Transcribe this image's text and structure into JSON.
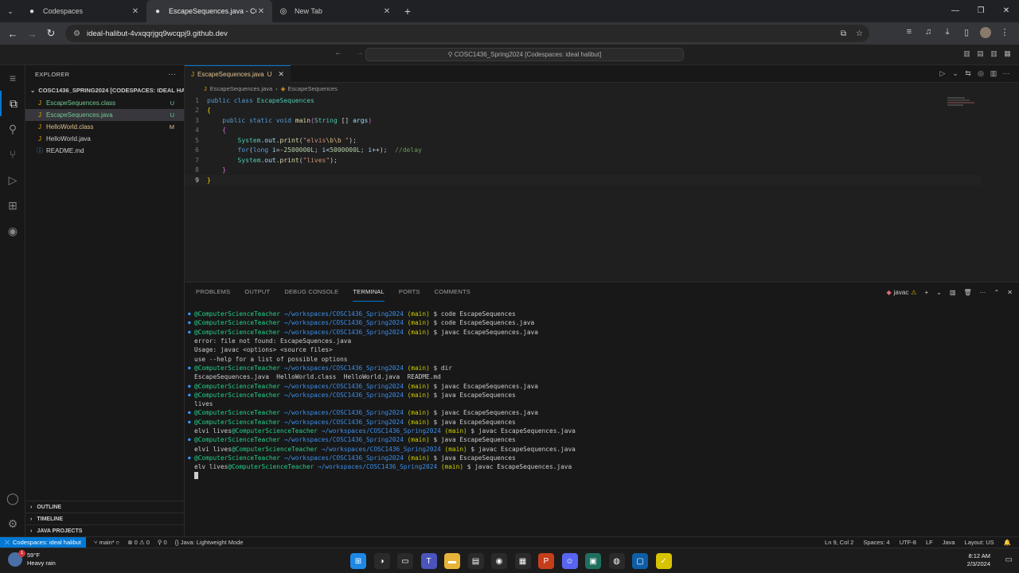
{
  "browser": {
    "tabs": [
      {
        "title": "Codespaces",
        "icon": "github-icon",
        "active": false
      },
      {
        "title": "EscapeSequences.java - COSC1",
        "icon": "github-icon",
        "active": true
      },
      {
        "title": "New Tab",
        "icon": "chrome-icon",
        "active": false
      }
    ],
    "url": "ideal-halibut-4vxqqrjgq9wcqpj9.github.dev"
  },
  "vscode": {
    "command_center": "COSC1436_Spring2024 [Codespaces: ideal halibut]",
    "explorer": {
      "title": "EXPLORER",
      "folder": "COSC1436_SPRING2024 [CODESPACES: IDEAL HALI...",
      "files": [
        {
          "name": "EscapeSequences.class",
          "status": "U",
          "color": "#73c991",
          "icon_color": "#e2a000",
          "selected": false
        },
        {
          "name": "EscapeSequences.java",
          "status": "U",
          "color": "#73c991",
          "icon_color": "#e2a000",
          "selected": true
        },
        {
          "name": "HelloWorld.class",
          "status": "M",
          "color": "#e2c08d",
          "icon_color": "#e2a000",
          "selected": false
        },
        {
          "name": "HelloWorld.java",
          "status": "",
          "color": "#cccccc",
          "icon_color": "#e2a000",
          "selected": false
        },
        {
          "name": "README.md",
          "status": "",
          "color": "#cccccc",
          "icon_color": "#519aba",
          "selected": false
        }
      ],
      "sections": [
        "OUTLINE",
        "TIMELINE",
        "JAVA PROJECTS"
      ]
    },
    "editor": {
      "tab_name": "EscapeSequences.java",
      "tab_status": "U",
      "breadcrumb": [
        "EscapeSequences.java",
        "EscapeSequences"
      ],
      "lines": [
        {
          "n": "1",
          "tokens": [
            [
              "kw",
              "public "
            ],
            [
              "kw",
              "class "
            ],
            [
              "ty",
              "EscapeSequences"
            ]
          ]
        },
        {
          "n": "2",
          "tokens": [
            [
              "pu",
              "{"
            ]
          ]
        },
        {
          "n": "3",
          "tokens": [
            [
              "",
              "    "
            ],
            [
              "kw",
              "public "
            ],
            [
              "kw",
              "static "
            ],
            [
              "kw",
              "void "
            ],
            [
              "fn",
              "main"
            ],
            [
              "pu2",
              "("
            ],
            [
              "ty",
              "String "
            ],
            [
              "",
              "[] "
            ],
            [
              "va",
              "args"
            ],
            [
              "pu2",
              ")"
            ]
          ]
        },
        {
          "n": "4",
          "tokens": [
            [
              "",
              "    "
            ],
            [
              "pu2",
              "{"
            ]
          ]
        },
        {
          "n": "5",
          "tokens": [
            [
              "",
              "        "
            ],
            [
              "ty",
              "System"
            ],
            [
              "",
              "."
            ],
            [
              "va",
              "out"
            ],
            [
              "",
              "."
            ],
            [
              "fn",
              "print"
            ],
            [
              "",
              "("
            ],
            [
              "str",
              "\"elvis"
            ],
            [
              "esc",
              "\\b\\b"
            ],
            [
              "str",
              " \""
            ],
            [
              "",
              ");"
            ]
          ]
        },
        {
          "n": "6",
          "tokens": [
            [
              "",
              "        "
            ],
            [
              "kw",
              "for"
            ],
            [
              "",
              "("
            ],
            [
              "kw",
              "long "
            ],
            [
              "va",
              "i"
            ],
            [
              "",
              "=-"
            ],
            [
              "num2",
              "2500000L"
            ],
            [
              "",
              "; "
            ],
            [
              "va",
              "i"
            ],
            [
              "",
              "<"
            ],
            [
              "num2",
              "5000000L"
            ],
            [
              "",
              "; "
            ],
            [
              "va",
              "i"
            ],
            [
              "",
              "++);  "
            ],
            [
              "cm",
              "//delay"
            ]
          ]
        },
        {
          "n": "7",
          "tokens": [
            [
              "",
              "        "
            ],
            [
              "ty",
              "System"
            ],
            [
              "",
              "."
            ],
            [
              "va",
              "out"
            ],
            [
              "",
              "."
            ],
            [
              "fn",
              "print"
            ],
            [
              "",
              "("
            ],
            [
              "str",
              "\"lives\""
            ],
            [
              "",
              ");"
            ]
          ]
        },
        {
          "n": "8",
          "tokens": [
            [
              "",
              "    "
            ],
            [
              "pu2",
              "}"
            ]
          ]
        },
        {
          "n": "9",
          "tokens": [
            [
              "pu",
              "}"
            ]
          ],
          "current": true
        }
      ]
    },
    "panel": {
      "tabs": [
        "PROBLEMS",
        "OUTPUT",
        "DEBUG CONSOLE",
        "TERMINAL",
        "PORTS",
        "COMMENTS"
      ],
      "active_tab": "TERMINAL",
      "shell": "javac",
      "terminal": [
        {
          "dot": true,
          "pre": "",
          "user": "@ComputerScienceTeacher",
          "path": "→/workspaces/COSC1436_Spring2024",
          "branch": "(main)",
          "cmd": "$ code EscapeSequences"
        },
        {
          "dot": true,
          "pre": "",
          "user": "@ComputerScienceTeacher",
          "path": "→/workspaces/COSC1436_Spring2024",
          "branch": "(main)",
          "cmd": "$ code EscapeSequences.java"
        },
        {
          "dot": true,
          "pre": "",
          "user": "@ComputerScienceTeacher",
          "path": "→/workspaces/COSC1436_Spring2024",
          "branch": "(main)",
          "cmd": "$ javac EscapeSequences.java"
        },
        {
          "dot": false,
          "text": "error: file not found: EscapeSquences.java"
        },
        {
          "dot": false,
          "text": "Usage: javac <options> <source files>"
        },
        {
          "dot": false,
          "text": "use --help for a list of possible options"
        },
        {
          "dot": true,
          "pre": "",
          "user": "@ComputerScienceTeacher",
          "path": "→/workspaces/COSC1436_Spring2024",
          "branch": "(main)",
          "cmd": "$ dir"
        },
        {
          "dot": false,
          "text": "EscapeSequences.java  HelloWorld.class  HelloWorld.java  README.md"
        },
        {
          "dot": true,
          "pre": "",
          "user": "@ComputerScienceTeacher",
          "path": "→/workspaces/COSC1436_Spring2024",
          "branch": "(main)",
          "cmd": "$ javac EscapeSequences.java"
        },
        {
          "dot": true,
          "pre": "",
          "user": "@ComputerScienceTeacher",
          "path": "→/workspaces/COSC1436_Spring2024",
          "branch": "(main)",
          "cmd": "$ java EscapeSequences"
        },
        {
          "dot": false,
          "text": "lives"
        },
        {
          "dot": true,
          "pre": "",
          "user": "@ComputerScienceTeacher",
          "path": "→/workspaces/COSC1436_Spring2024",
          "branch": "(main)",
          "cmd": "$ javac EscapeSequences.java"
        },
        {
          "dot": true,
          "pre": "",
          "user": "@ComputerScienceTeacher",
          "path": "→/workspaces/COSC1436_Spring2024",
          "branch": "(main)",
          "cmd": "$ java EscapeSequences"
        },
        {
          "dot": false,
          "pre": "elvi lives",
          "user": "@ComputerScienceTeacher",
          "path": "→/workspaces/COSC1436_Spring2024",
          "branch": "(main)",
          "cmd": "$ javac EscapeSequences.java"
        },
        {
          "dot": true,
          "pre": "",
          "user": "@ComputerScienceTeacher",
          "path": "→/workspaces/COSC1436_Spring2024",
          "branch": "(main)",
          "cmd": "$ java EscapeSequences"
        },
        {
          "dot": false,
          "pre": "elvi lives",
          "user": "@ComputerScienceTeacher",
          "path": "→/workspaces/COSC1436_Spring2024",
          "branch": "(main)",
          "cmd": "$ javac EscapeSequences.java"
        },
        {
          "dot": true,
          "pre": "",
          "user": "@ComputerScienceTeacher",
          "path": "→/workspaces/COSC1436_Spring2024",
          "branch": "(main)",
          "cmd": "$ java EscapeSequences"
        },
        {
          "dot": false,
          "pre": "elv lives",
          "user": "@ComputerScienceTeacher",
          "path": "→/workspaces/COSC1436_Spring2024",
          "branch": "(main)",
          "cmd": "$ javac EscapeSequences.java"
        }
      ]
    },
    "status": {
      "remote": "Codespaces: ideal halibut",
      "branch": "main*",
      "problems": "⊗ 0 ⚠ 0",
      "ports": "⚲ 0",
      "java_mode": "Java: Lightweight Mode",
      "cursor": "Ln 9, Col 2",
      "spaces": "Spaces: 4",
      "encoding": "UTF-8",
      "eol": "LF",
      "language": "Java",
      "layout": "Layout: US"
    }
  },
  "taskbar": {
    "weather_temp": "59°F",
    "weather_desc": "Heavy rain",
    "weather_badge": "1",
    "time": "8:12 AM",
    "date": "2/3/2024",
    "apps": [
      {
        "name": "start-button",
        "color": "#1e88e5",
        "glyph": "⊞"
      },
      {
        "name": "copilot-icon",
        "color": "#2a2a2a",
        "glyph": "◑"
      },
      {
        "name": "file-manager-icon",
        "color": "#2a2a2a",
        "glyph": "▭"
      },
      {
        "name": "teams-icon",
        "color": "#4b53bc",
        "glyph": "T"
      },
      {
        "name": "folder-icon",
        "color": "#e8b339",
        "glyph": "▬"
      },
      {
        "name": "notepad-icon",
        "color": "#2a2a2a",
        "glyph": "▤"
      },
      {
        "name": "chrome-icon",
        "color": "#2a2a2a",
        "glyph": "◉"
      },
      {
        "name": "calculator-icon",
        "color": "#2a2a2a",
        "glyph": "▦"
      },
      {
        "name": "powerpoint-icon",
        "color": "#c43e1c",
        "glyph": "P"
      },
      {
        "name": "discord-icon",
        "color": "#5865f2",
        "glyph": "☺"
      },
      {
        "name": "terminal-icon",
        "color": "#1f6f5f",
        "glyph": "▣"
      },
      {
        "name": "github-desktop-icon",
        "color": "#2a2a2a",
        "glyph": "◍"
      },
      {
        "name": "remote-desktop-icon",
        "color": "#0d5ea6",
        "glyph": "▢"
      },
      {
        "name": "sticky-app-icon",
        "color": "#d8c300",
        "glyph": "✓"
      }
    ]
  }
}
